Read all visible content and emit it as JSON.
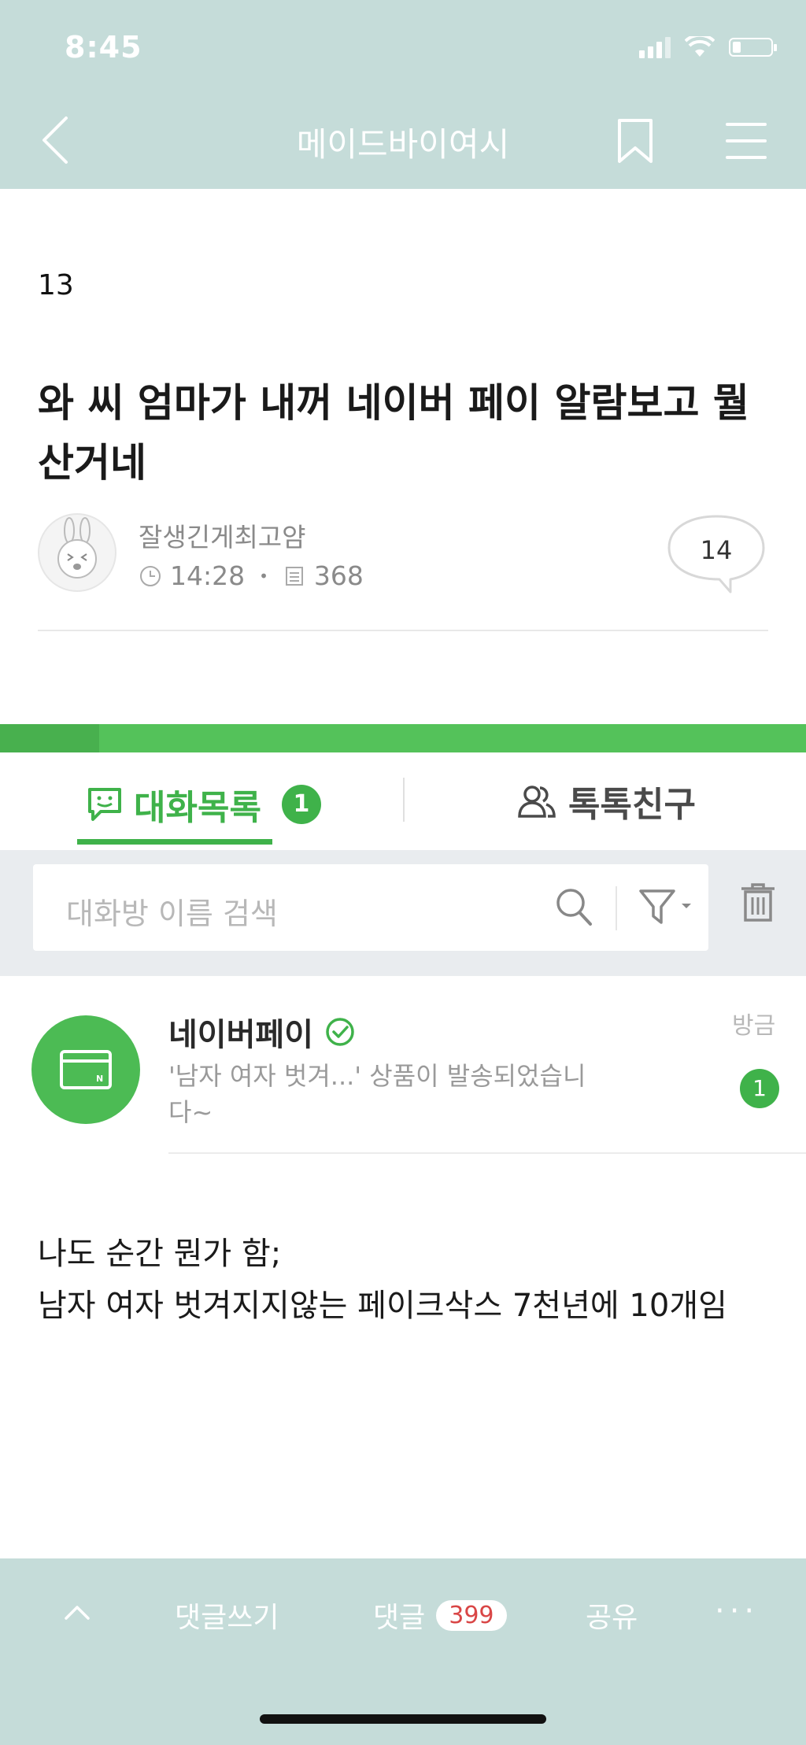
{
  "status_bar": {
    "time": "8:45"
  },
  "nav": {
    "title": "메이드바이여시"
  },
  "post": {
    "number": "13",
    "title": "와 씨 엄마가 내꺼 네이버 페이 알람보고 뭘 산거네",
    "author": "잘생긴게최고얌",
    "time": "14:28",
    "views": "368",
    "comment_count": "14"
  },
  "screenshot": {
    "tab_chats_label": "대화목록",
    "tab_chats_badge": "1",
    "tab_friends_label": "톡톡친구",
    "search_placeholder": "대화방 이름 검색",
    "chat": {
      "name": "네이버페이",
      "message": "'남자 여자 벗겨...' 상품이 발송되었습니다~",
      "time": "방금",
      "unread": "1",
      "card_text": "N"
    }
  },
  "body": {
    "line1": "나도 순간 뭔가 함;",
    "line2": "남자 여자 벗겨지지않는 페이크삭스 7천년에 10개임"
  },
  "bottom_bar": {
    "write_label": "댓글쓰기",
    "comment_label": "댓글",
    "comment_count": "399",
    "share_label": "공유",
    "more_label": "···"
  },
  "colors": {
    "bar": "#c5dcd9",
    "accent_green": "#3fb24a",
    "badge_red": "#d94646"
  },
  "icons": [
    "back-chevron-icon",
    "bookmark-icon",
    "menu-icon",
    "clock-icon",
    "document-icon",
    "speech-bubble-icon",
    "chat-icon",
    "friends-icon",
    "search-icon",
    "filter-icon",
    "trash-icon",
    "card-icon",
    "verified-icon",
    "chevron-up-icon"
  ]
}
